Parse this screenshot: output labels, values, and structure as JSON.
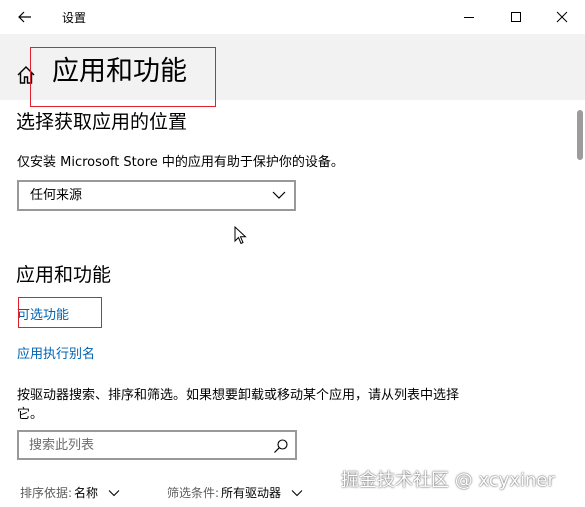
{
  "window": {
    "title": "设置"
  },
  "header": {
    "title": "应用和功能"
  },
  "location_section": {
    "heading": "选择获取应用的位置",
    "description": "仅安装 Microsoft Store 中的应用有助于保护你的设备。",
    "dropdown_value": "任何来源"
  },
  "apps_section": {
    "heading": "应用和功能",
    "link_optional_features": "可选功能",
    "link_app_aliases": "应用执行别名",
    "description": "按驱动器搜索、排序和筛选。如果想要卸载或移动某个应用，请从列表中选择它。",
    "search_placeholder": "搜索此列表",
    "sort_label": "排序依据:",
    "sort_value": "名称",
    "filter_label": "筛选条件:",
    "filter_value": "所有驱动器"
  },
  "watermark": "掘金技术社区 @ xcyxiner",
  "icons": {
    "back": "back-arrow-icon",
    "home": "home-icon",
    "minimize": "minimize-icon",
    "maximize": "maximize-icon",
    "close": "close-icon",
    "dropdown": "chevron-down-icon",
    "search": "search-icon",
    "cursor": "mouse-pointer-icon"
  },
  "colors": {
    "link": "#0063b1",
    "header_bg": "#f2f2f2",
    "highlight_border": "#e0202a",
    "control_border": "#999999"
  }
}
